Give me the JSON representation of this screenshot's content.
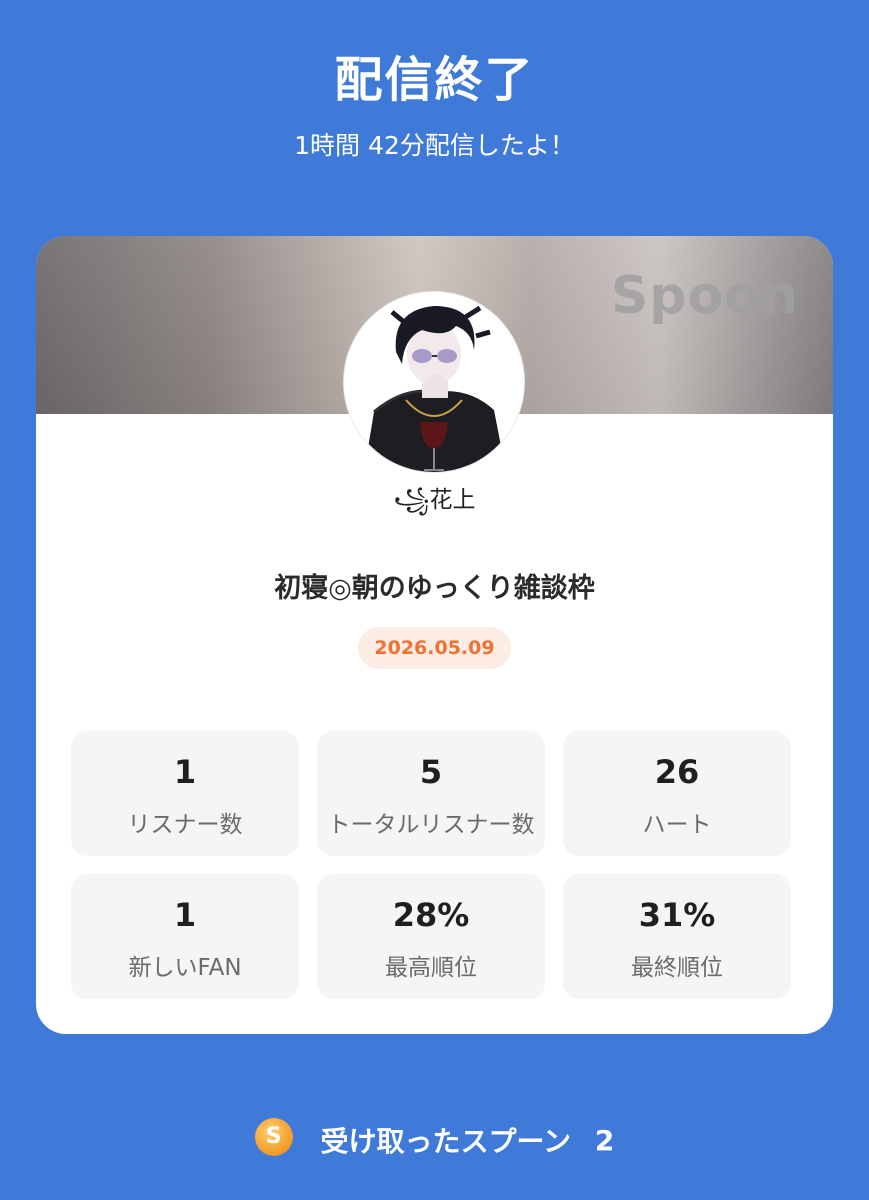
{
  "header": {
    "title": "配信終了",
    "subtitle": "1時間 42分配信したよ！"
  },
  "card": {
    "brand": "Spoon",
    "username": "꧁花上",
    "live_title": "初寝◎朝のゆっくり雑談枠",
    "date": "2026.05.09"
  },
  "stats": [
    {
      "value": "1",
      "label": "リスナー数"
    },
    {
      "value": "5",
      "label": "トータルリスナー数"
    },
    {
      "value": "26",
      "label": "ハート"
    },
    {
      "value": "1",
      "label": "新しいFAN"
    },
    {
      "value": "28%",
      "label": "最高順位"
    },
    {
      "value": "31%",
      "label": "最終順位"
    }
  ],
  "footer": {
    "coin_icon": "S",
    "spoons_label": "受け取ったスプーン",
    "spoons_count": "2"
  },
  "colors": {
    "background": "#3f7ad8",
    "accent": "#f07232",
    "coin": "#f6a433"
  }
}
